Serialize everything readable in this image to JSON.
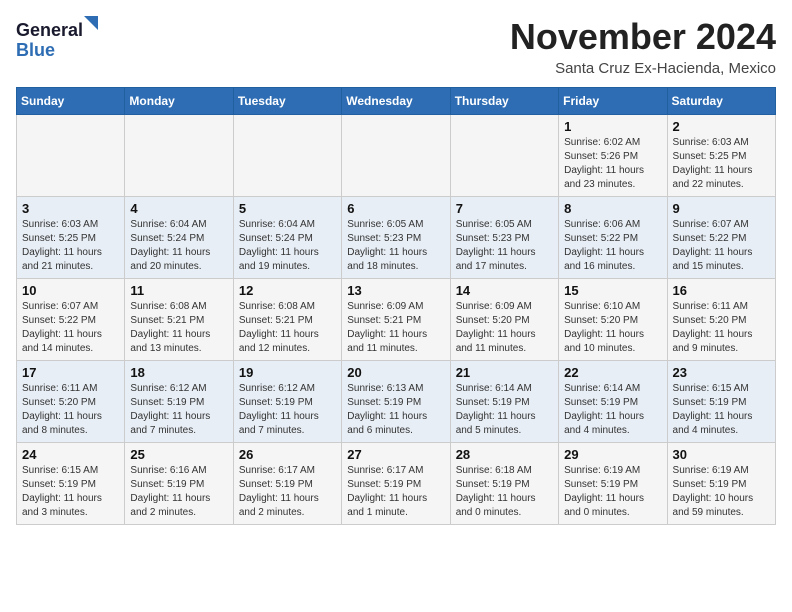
{
  "header": {
    "logo_line1": "General",
    "logo_line2": "Blue",
    "month": "November 2024",
    "location": "Santa Cruz Ex-Hacienda, Mexico"
  },
  "weekdays": [
    "Sunday",
    "Monday",
    "Tuesday",
    "Wednesday",
    "Thursday",
    "Friday",
    "Saturday"
  ],
  "weeks": [
    [
      {
        "day": "",
        "sunrise": "",
        "sunset": "",
        "daylight": ""
      },
      {
        "day": "",
        "sunrise": "",
        "sunset": "",
        "daylight": ""
      },
      {
        "day": "",
        "sunrise": "",
        "sunset": "",
        "daylight": ""
      },
      {
        "day": "",
        "sunrise": "",
        "sunset": "",
        "daylight": ""
      },
      {
        "day": "",
        "sunrise": "",
        "sunset": "",
        "daylight": ""
      },
      {
        "day": "1",
        "sunrise": "Sunrise: 6:02 AM",
        "sunset": "Sunset: 5:26 PM",
        "daylight": "Daylight: 11 hours and 23 minutes."
      },
      {
        "day": "2",
        "sunrise": "Sunrise: 6:03 AM",
        "sunset": "Sunset: 5:25 PM",
        "daylight": "Daylight: 11 hours and 22 minutes."
      }
    ],
    [
      {
        "day": "3",
        "sunrise": "Sunrise: 6:03 AM",
        "sunset": "Sunset: 5:25 PM",
        "daylight": "Daylight: 11 hours and 21 minutes."
      },
      {
        "day": "4",
        "sunrise": "Sunrise: 6:04 AM",
        "sunset": "Sunset: 5:24 PM",
        "daylight": "Daylight: 11 hours and 20 minutes."
      },
      {
        "day": "5",
        "sunrise": "Sunrise: 6:04 AM",
        "sunset": "Sunset: 5:24 PM",
        "daylight": "Daylight: 11 hours and 19 minutes."
      },
      {
        "day": "6",
        "sunrise": "Sunrise: 6:05 AM",
        "sunset": "Sunset: 5:23 PM",
        "daylight": "Daylight: 11 hours and 18 minutes."
      },
      {
        "day": "7",
        "sunrise": "Sunrise: 6:05 AM",
        "sunset": "Sunset: 5:23 PM",
        "daylight": "Daylight: 11 hours and 17 minutes."
      },
      {
        "day": "8",
        "sunrise": "Sunrise: 6:06 AM",
        "sunset": "Sunset: 5:22 PM",
        "daylight": "Daylight: 11 hours and 16 minutes."
      },
      {
        "day": "9",
        "sunrise": "Sunrise: 6:07 AM",
        "sunset": "Sunset: 5:22 PM",
        "daylight": "Daylight: 11 hours and 15 minutes."
      }
    ],
    [
      {
        "day": "10",
        "sunrise": "Sunrise: 6:07 AM",
        "sunset": "Sunset: 5:22 PM",
        "daylight": "Daylight: 11 hours and 14 minutes."
      },
      {
        "day": "11",
        "sunrise": "Sunrise: 6:08 AM",
        "sunset": "Sunset: 5:21 PM",
        "daylight": "Daylight: 11 hours and 13 minutes."
      },
      {
        "day": "12",
        "sunrise": "Sunrise: 6:08 AM",
        "sunset": "Sunset: 5:21 PM",
        "daylight": "Daylight: 11 hours and 12 minutes."
      },
      {
        "day": "13",
        "sunrise": "Sunrise: 6:09 AM",
        "sunset": "Sunset: 5:21 PM",
        "daylight": "Daylight: 11 hours and 11 minutes."
      },
      {
        "day": "14",
        "sunrise": "Sunrise: 6:09 AM",
        "sunset": "Sunset: 5:20 PM",
        "daylight": "Daylight: 11 hours and 11 minutes."
      },
      {
        "day": "15",
        "sunrise": "Sunrise: 6:10 AM",
        "sunset": "Sunset: 5:20 PM",
        "daylight": "Daylight: 11 hours and 10 minutes."
      },
      {
        "day": "16",
        "sunrise": "Sunrise: 6:11 AM",
        "sunset": "Sunset: 5:20 PM",
        "daylight": "Daylight: 11 hours and 9 minutes."
      }
    ],
    [
      {
        "day": "17",
        "sunrise": "Sunrise: 6:11 AM",
        "sunset": "Sunset: 5:20 PM",
        "daylight": "Daylight: 11 hours and 8 minutes."
      },
      {
        "day": "18",
        "sunrise": "Sunrise: 6:12 AM",
        "sunset": "Sunset: 5:19 PM",
        "daylight": "Daylight: 11 hours and 7 minutes."
      },
      {
        "day": "19",
        "sunrise": "Sunrise: 6:12 AM",
        "sunset": "Sunset: 5:19 PM",
        "daylight": "Daylight: 11 hours and 7 minutes."
      },
      {
        "day": "20",
        "sunrise": "Sunrise: 6:13 AM",
        "sunset": "Sunset: 5:19 PM",
        "daylight": "Daylight: 11 hours and 6 minutes."
      },
      {
        "day": "21",
        "sunrise": "Sunrise: 6:14 AM",
        "sunset": "Sunset: 5:19 PM",
        "daylight": "Daylight: 11 hours and 5 minutes."
      },
      {
        "day": "22",
        "sunrise": "Sunrise: 6:14 AM",
        "sunset": "Sunset: 5:19 PM",
        "daylight": "Daylight: 11 hours and 4 minutes."
      },
      {
        "day": "23",
        "sunrise": "Sunrise: 6:15 AM",
        "sunset": "Sunset: 5:19 PM",
        "daylight": "Daylight: 11 hours and 4 minutes."
      }
    ],
    [
      {
        "day": "24",
        "sunrise": "Sunrise: 6:15 AM",
        "sunset": "Sunset: 5:19 PM",
        "daylight": "Daylight: 11 hours and 3 minutes."
      },
      {
        "day": "25",
        "sunrise": "Sunrise: 6:16 AM",
        "sunset": "Sunset: 5:19 PM",
        "daylight": "Daylight: 11 hours and 2 minutes."
      },
      {
        "day": "26",
        "sunrise": "Sunrise: 6:17 AM",
        "sunset": "Sunset: 5:19 PM",
        "daylight": "Daylight: 11 hours and 2 minutes."
      },
      {
        "day": "27",
        "sunrise": "Sunrise: 6:17 AM",
        "sunset": "Sunset: 5:19 PM",
        "daylight": "Daylight: 11 hours and 1 minute."
      },
      {
        "day": "28",
        "sunrise": "Sunrise: 6:18 AM",
        "sunset": "Sunset: 5:19 PM",
        "daylight": "Daylight: 11 hours and 0 minutes."
      },
      {
        "day": "29",
        "sunrise": "Sunrise: 6:19 AM",
        "sunset": "Sunset: 5:19 PM",
        "daylight": "Daylight: 11 hours and 0 minutes."
      },
      {
        "day": "30",
        "sunrise": "Sunrise: 6:19 AM",
        "sunset": "Sunset: 5:19 PM",
        "daylight": "Daylight: 10 hours and 59 minutes."
      }
    ]
  ]
}
